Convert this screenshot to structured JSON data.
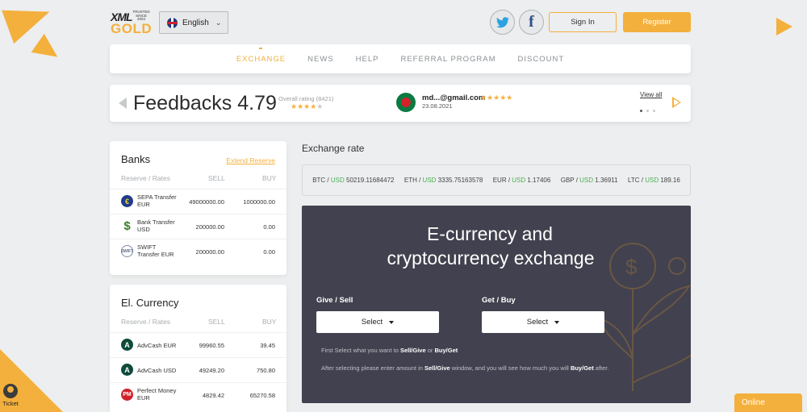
{
  "header": {
    "logo": {
      "top": "XML",
      "trust": "TRUSTED SINCE 2004",
      "bottom": "GOLD"
    },
    "language": "English",
    "social": [
      {
        "icon": "twitter-icon"
      },
      {
        "icon": "facebook-icon"
      }
    ],
    "signin_label": "Sign In",
    "register_label": "Register"
  },
  "nav": {
    "items": [
      {
        "label": "EXCHANGE",
        "active": true
      },
      {
        "label": "NEWS"
      },
      {
        "label": "HELP"
      },
      {
        "label": "REFERRAL PROGRAM"
      },
      {
        "label": "DISCOUNT"
      }
    ]
  },
  "feedback": {
    "title": "Feedbacks 4.79",
    "rating_label": "Overall rating (8421)",
    "rating_stars": 4,
    "latest": {
      "email": "md...@gmail.com",
      "stars": 5,
      "date": "23.08.2021"
    },
    "view_all_label": "View all",
    "slide_index": 0,
    "slide_count": 3
  },
  "banks": {
    "title": "Banks",
    "link_label": "Extend Reserve",
    "columns": [
      "Reserve / Rates",
      "SELL",
      "BUY"
    ],
    "rows": [
      {
        "icon": "euro-icon",
        "name": "SEPA Transfer EUR",
        "sell": "49000000.00",
        "buy": "1000000.00"
      },
      {
        "icon": "dollar-icon",
        "name": "Bank Transfer USD",
        "sell": "200000.00",
        "buy": "0.00"
      },
      {
        "icon": "swift-icon",
        "name": "SWIFT Transfer EUR",
        "sell": "200000.00",
        "buy": "0.00"
      }
    ]
  },
  "ecurrency": {
    "title": "El. Currency",
    "columns": [
      "Reserve / Rates",
      "SELL",
      "BUY"
    ],
    "rows": [
      {
        "icon": "advcash-icon",
        "name": "AdvCash EUR",
        "sell": "99960.55",
        "buy": "39.45"
      },
      {
        "icon": "advcash-icon",
        "name": "AdvCash USD",
        "sell": "49249.20",
        "buy": "750.80"
      },
      {
        "icon": "perfect-money-icon",
        "name": "Perfect Money EUR",
        "sell": "4829.42",
        "buy": "65270.58"
      }
    ]
  },
  "exchange_rate": {
    "title": "Exchange rate",
    "items": [
      {
        "coin": "BTC",
        "sep": " / ",
        "quote": "USD",
        "value": "50219.11684472"
      },
      {
        "coin": "ETH",
        "sep": " / ",
        "quote": "USD",
        "value": "3335.75163578"
      },
      {
        "coin": "EUR",
        "sep": " / ",
        "quote": "USD",
        "value": "1.17406"
      },
      {
        "coin": "GBP",
        "sep": " / ",
        "quote": "USD",
        "value": "1.36911"
      },
      {
        "coin": "LTC",
        "sep": " / ",
        "quote": "USD",
        "value": "189.16"
      }
    ]
  },
  "exchange_widget": {
    "headline_1": "E-currency and",
    "headline_2": "cryptocurrency exchange",
    "give_label": "Give / Sell",
    "get_label": "Get / Buy",
    "give_select": "Select",
    "get_select": "Select",
    "note1": {
      "a": "First Select what you want to ",
      "b": "Sell/Give",
      "c": " or ",
      "d": "Buy/Get"
    },
    "note2": {
      "a": "After selecting please enter amount in ",
      "b": "Sell/Give",
      "c": " window, and you will see how much you will ",
      "d": "Buy/Get",
      "e": " after."
    }
  },
  "ticket_label": "Ticket",
  "online_label": "Online",
  "colors": {
    "accent": "#f4b03c",
    "panel_dark": "#42414f",
    "usd_green": "#4caf50"
  }
}
